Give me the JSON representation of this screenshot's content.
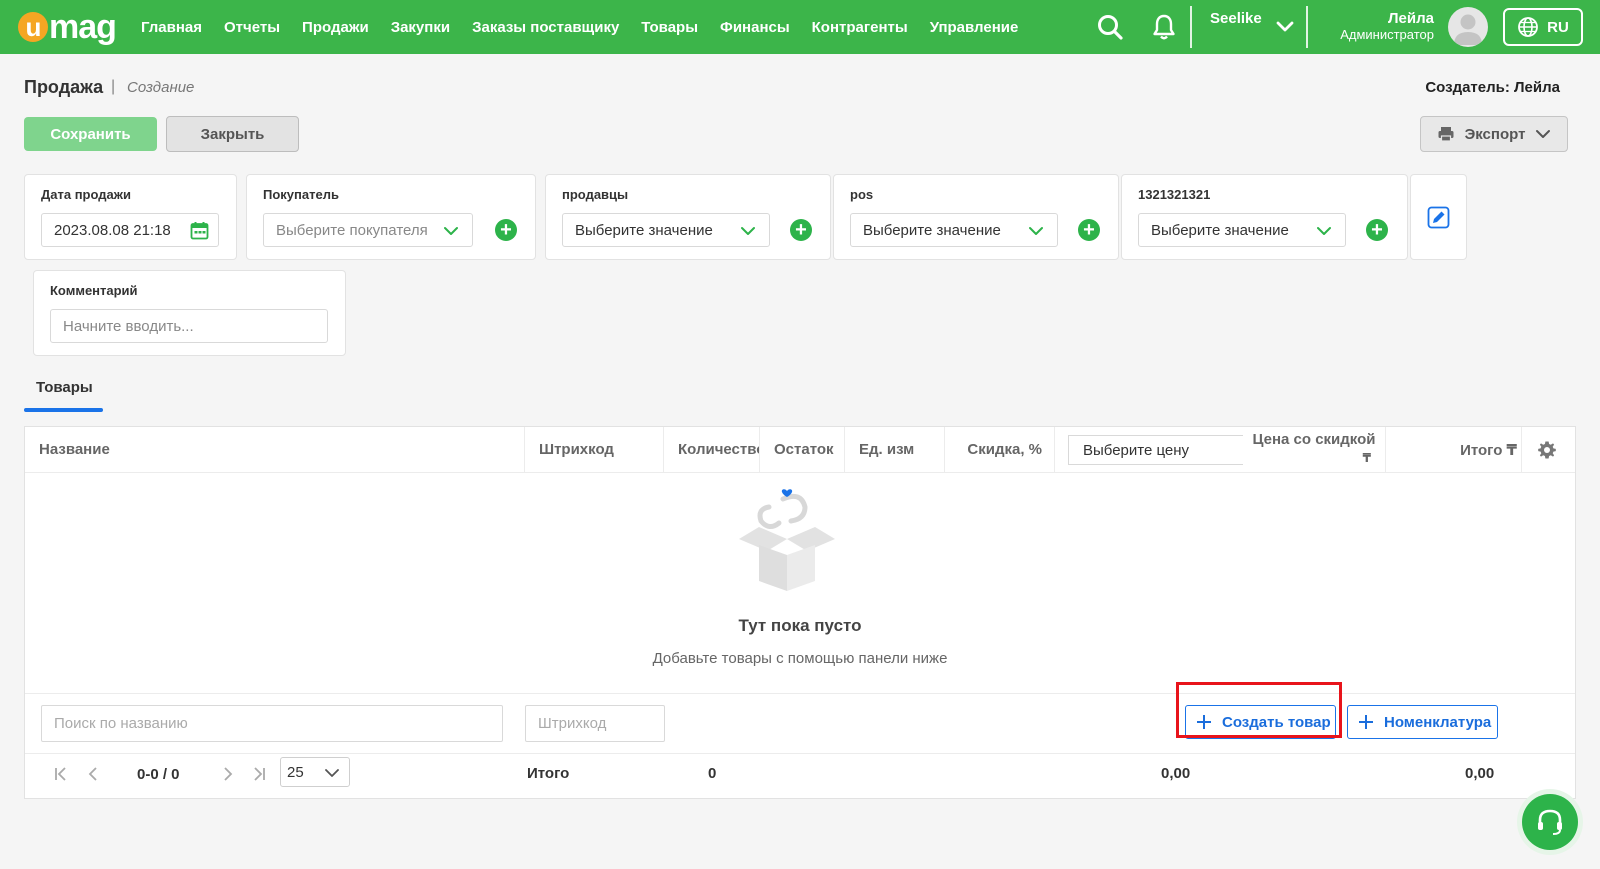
{
  "header": {
    "logo": "umag",
    "nav": [
      "Главная",
      "Отчеты",
      "Продажи",
      "Закупки",
      "Заказы поставщику",
      "Товары",
      "Финансы",
      "Контрагенты",
      "Управление"
    ],
    "company": "Seelike",
    "user_name": "Лейла",
    "user_role": "Администратор",
    "language": "RU",
    "brand_color": "#3cb54a"
  },
  "page": {
    "title": "Продажа",
    "separator": "|",
    "subtitle": "Создание",
    "creator": "Создатель: Лейла"
  },
  "toolbar": {
    "save_label": "Сохранить",
    "close_label": "Закрыть",
    "export_label": "Экспорт"
  },
  "form": {
    "sale_date_label": "Дата продажи",
    "sale_date_value": "2023.08.08 21:18",
    "buyer_label": "Покупатель",
    "buyer_placeholder": "Выберите покупателя",
    "sellers_label": "продавцы",
    "sellers_placeholder": "Выберите значение",
    "pos_label": "pos",
    "pos_placeholder": "Выберите значение",
    "custom_label": "1321321321",
    "custom_placeholder": "Выберите значение",
    "comment_label": "Комментарий",
    "comment_placeholder": "Начните вводить..."
  },
  "tabs": {
    "products": "Товары"
  },
  "table": {
    "columns": {
      "name": "Название",
      "barcode": "Штрихкод",
      "quantity": "Количество",
      "stock": "Остаток",
      "unit": "Ед. изм",
      "discount": "Скидка, %",
      "price_select": "Выберите цену",
      "discounted_price": "Цена со скидкой",
      "discounted_price_currency": "₸",
      "total": "Итого ₸"
    },
    "empty_title": "Тут пока пусто",
    "empty_subtitle": "Добавьте товары с помощью панели ниже",
    "search_placeholder": "Поиск по названию",
    "barcode_placeholder": "Штрихкод",
    "create_product_label": "Создать товар",
    "nomenclature_label": "Номенклатура",
    "pagination": "0-0 / 0",
    "page_size": "25",
    "totals_label": "Итого",
    "total_quantity": "0",
    "total_discounted": "0,00",
    "total_sum": "0,00"
  }
}
